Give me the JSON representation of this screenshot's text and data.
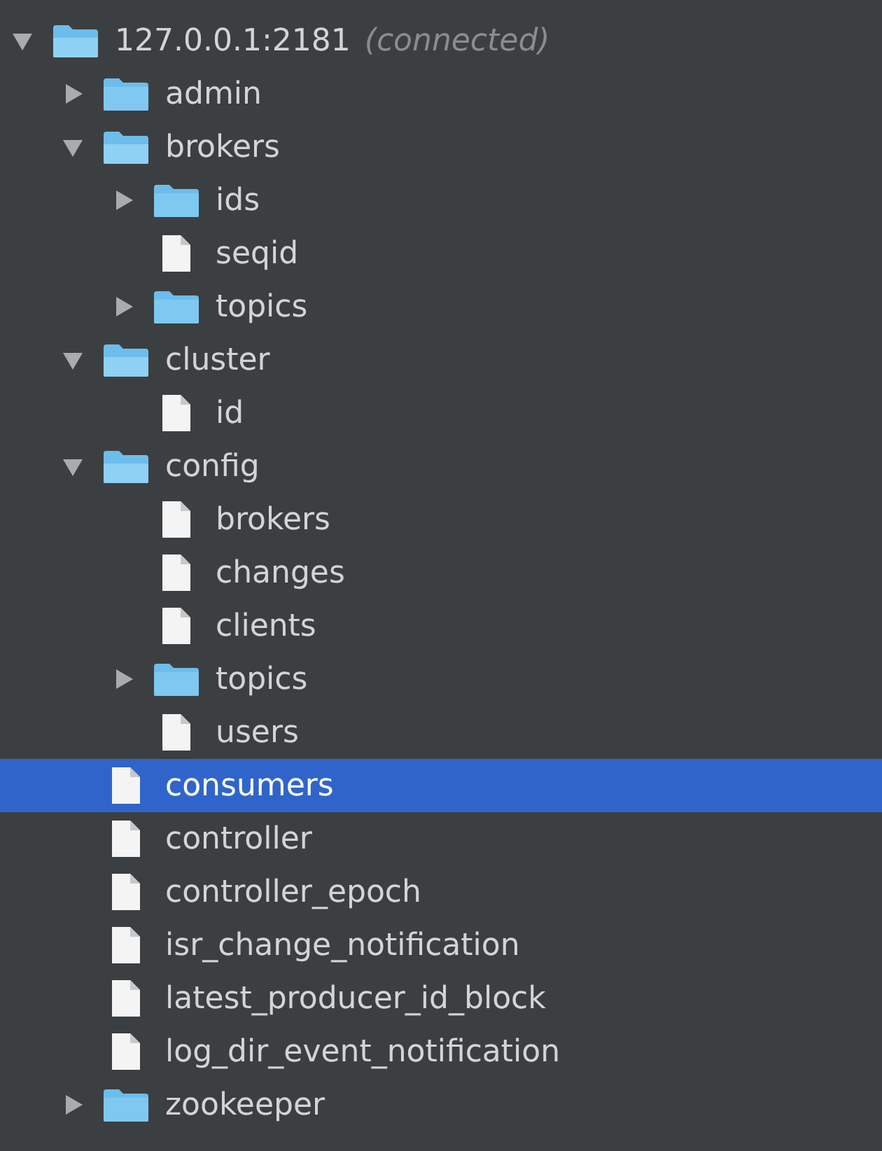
{
  "tree": {
    "label": "127.0.0.1:2181",
    "status": "(connected)",
    "kind": "folder",
    "expanded": true,
    "selected": false,
    "children": [
      {
        "label": "admin",
        "kind": "folder",
        "expanded": false,
        "selected": false
      },
      {
        "label": "brokers",
        "kind": "folder",
        "expanded": true,
        "selected": false,
        "children": [
          {
            "label": "ids",
            "kind": "folder",
            "expanded": false,
            "selected": false
          },
          {
            "label": "seqid",
            "kind": "file",
            "selected": false
          },
          {
            "label": "topics",
            "kind": "folder",
            "expanded": false,
            "selected": false
          }
        ]
      },
      {
        "label": "cluster",
        "kind": "folder",
        "expanded": true,
        "selected": false,
        "children": [
          {
            "label": "id",
            "kind": "file",
            "selected": false
          }
        ]
      },
      {
        "label": "config",
        "kind": "folder",
        "expanded": true,
        "selected": false,
        "children": [
          {
            "label": "brokers",
            "kind": "file",
            "selected": false
          },
          {
            "label": "changes",
            "kind": "file",
            "selected": false
          },
          {
            "label": "clients",
            "kind": "file",
            "selected": false
          },
          {
            "label": "topics",
            "kind": "folder",
            "expanded": false,
            "selected": false
          },
          {
            "label": "users",
            "kind": "file",
            "selected": false
          }
        ]
      },
      {
        "label": "consumers",
        "kind": "file",
        "selected": true
      },
      {
        "label": "controller",
        "kind": "file",
        "selected": false
      },
      {
        "label": "controller_epoch",
        "kind": "file",
        "selected": false
      },
      {
        "label": "isr_change_notification",
        "kind": "file",
        "selected": false
      },
      {
        "label": "latest_producer_id_block",
        "kind": "file",
        "selected": false
      },
      {
        "label": "log_dir_event_notification",
        "kind": "file",
        "selected": false
      },
      {
        "label": "zookeeper",
        "kind": "folder",
        "expanded": false,
        "selected": false
      }
    ]
  }
}
